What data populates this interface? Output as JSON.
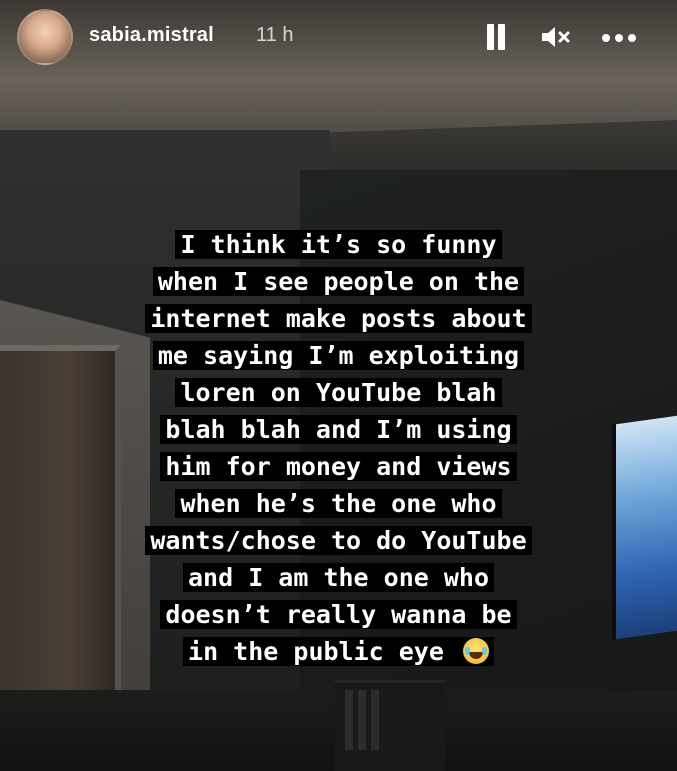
{
  "header": {
    "username": "sabia.mistral",
    "timestamp": "11 h",
    "icons": {
      "avatar": "profile-avatar",
      "pause": "pause-icon",
      "mute": "speaker-muted-icon",
      "more": "more-options-icon"
    }
  },
  "caption": {
    "lines": [
      "I think it’s so funny",
      "when I see people on the",
      "internet make posts about",
      "me saying I’m exploiting",
      "loren on YouTube blah",
      "blah blah and I’m using",
      "him for money and views",
      "when he’s the one who",
      "wants/chose to do YouTube",
      "and I am the one who",
      "doesn’t really wanna be",
      "in the public eye"
    ],
    "trailing_emoji": "face-with-tears-of-joy"
  },
  "colors": {
    "text": "#ffffff",
    "caption_background": "#000000"
  }
}
